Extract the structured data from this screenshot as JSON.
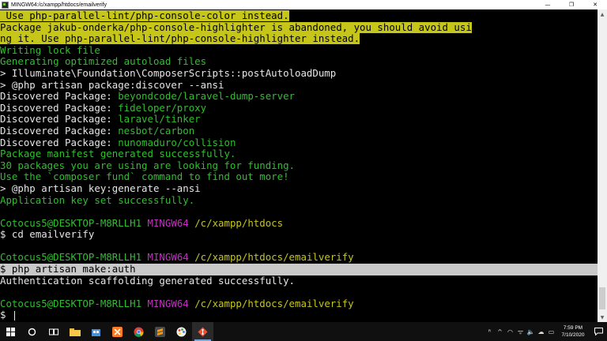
{
  "window": {
    "title": "MINGW64:/c/xampp/htdocs/emailverify",
    "controls": {
      "minimize": "—",
      "maximize": "❐",
      "close": "✕"
    }
  },
  "terminal": {
    "l01": " Use php-parallel-lint/php-console-color instead.",
    "l02": "Package jakub-onderka/php-console-highlighter is abandoned, you should avoid usi",
    "l03": "ng it. Use php-parallel-lint/php-console-highlighter instead.",
    "l04": "Writing lock file",
    "l05": "Generating optimized autoload files",
    "l06": "> Illuminate\\Foundation\\ComposerScripts::postAutoloadDump",
    "l07": "> @php artisan package:discover --ansi",
    "pkg_prefix": "Discovered Package: ",
    "packages": [
      "beyondcode/laravel-dump-server",
      "fideloper/proxy",
      "laravel/tinker",
      "nesbot/carbon",
      "nunomaduro/collision"
    ],
    "l13": "Package manifest generated successfully.",
    "l14": "30 packages you are using are looking for funding.",
    "l15": "Use the `composer fund` command to find out more!",
    "l16": "> @php artisan key:generate --ansi",
    "l17": "Application key set successfully.",
    "prompt_user": "Cotocus5@DESKTOP-M8RLLH1",
    "prompt_shell": "MINGW64",
    "path1": "/c/xampp/htdocs",
    "cmd1": "$ cd emailverify",
    "path2": "/c/xampp/htdocs/emailverify",
    "cmd2": "$ php artisan make:auth",
    "l25": "Authentication scaffolding generated successfully.",
    "path3": "/c/xampp/htdocs/emailverify",
    "cmd3": "$ "
  },
  "taskbar": {
    "time": "7:59 PM",
    "date": "7/10/2020",
    "colors": {
      "accent": "#7aa6d6"
    }
  }
}
